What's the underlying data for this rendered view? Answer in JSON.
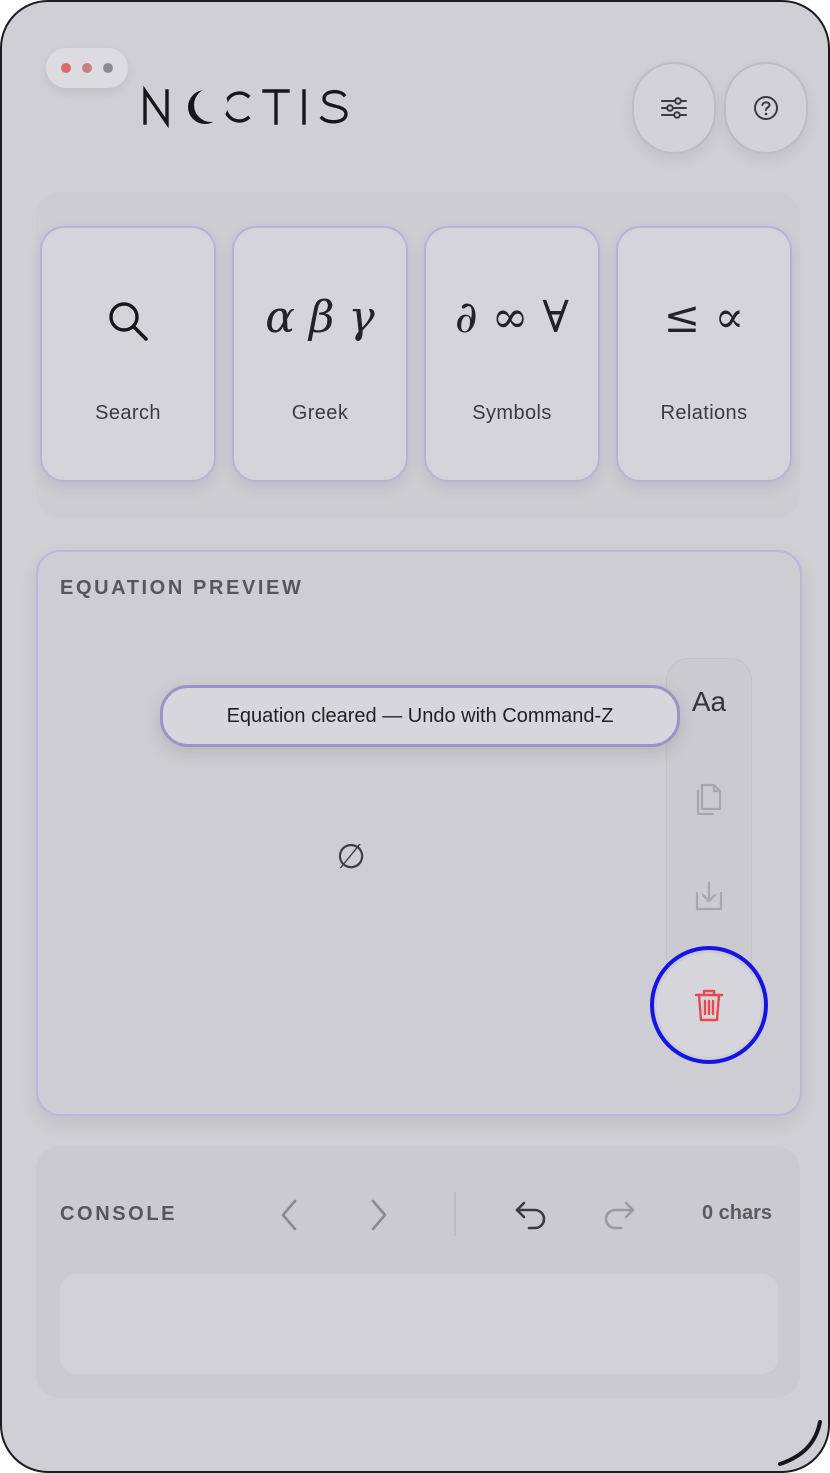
{
  "app": {
    "title": "NOCTIS",
    "accent_color": "#9b92c6",
    "danger_color": "#e5484d",
    "focus_ring_color": "#1414e6"
  },
  "window_controls": [
    {
      "name": "close",
      "color": "#d86a6a"
    },
    {
      "name": "minimize",
      "color": "#c77f86"
    },
    {
      "name": "zoom",
      "color": "#8a8a90"
    }
  ],
  "header": {
    "settings_icon": "sliders-icon",
    "help_icon": "help-circle-icon"
  },
  "palette": {
    "tiles": [
      {
        "id": "search",
        "glyph": "",
        "icon": "search-icon",
        "label": "Search"
      },
      {
        "id": "greek",
        "glyph": "α β γ",
        "icon": "greek-glyph",
        "label": "Greek"
      },
      {
        "id": "symbols",
        "glyph": "∂ ∞ ∀",
        "icon": "symbols-glyph",
        "label": "Symbols"
      },
      {
        "id": "relations",
        "glyph": "≤ ∝",
        "icon": "relations-glyph",
        "label": "Relations"
      }
    ]
  },
  "preview": {
    "title": "EQUATION PREVIEW",
    "empty_glyph": "∅",
    "toast": "Equation cleared — Undo with Command-Z",
    "tools": [
      {
        "id": "font",
        "label": "Aa",
        "icon": "font-size-icon"
      },
      {
        "id": "copy",
        "icon": "copy-icon"
      },
      {
        "id": "export",
        "icon": "download-icon"
      },
      {
        "id": "delete",
        "icon": "trash-icon"
      }
    ]
  },
  "console": {
    "title": "CONSOLE",
    "char_count": "0 chars",
    "buttons": [
      {
        "id": "prev",
        "icon": "chevron-left-icon"
      },
      {
        "id": "next",
        "icon": "chevron-right-icon"
      },
      {
        "id": "undo",
        "icon": "undo-icon"
      },
      {
        "id": "redo",
        "icon": "redo-icon"
      }
    ]
  }
}
